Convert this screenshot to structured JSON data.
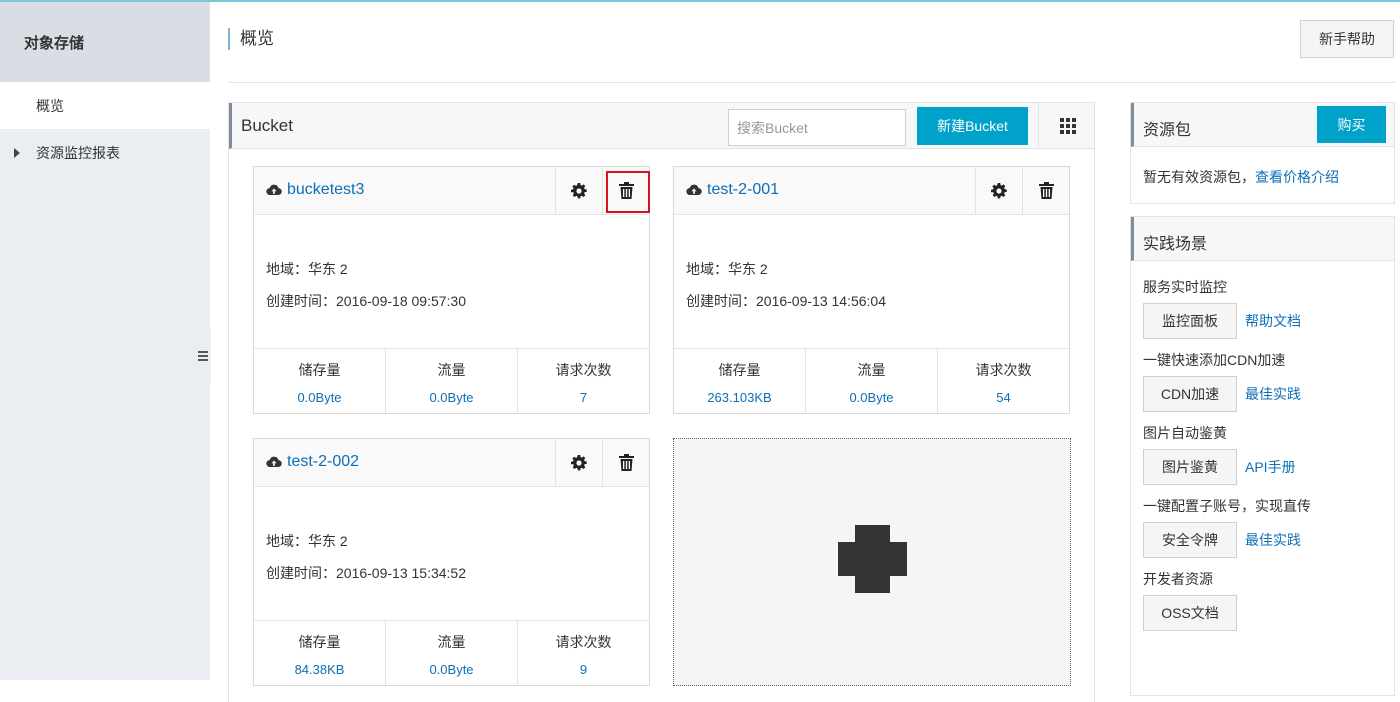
{
  "sidebar": {
    "title": "对象存储",
    "items": [
      {
        "label": "概览"
      },
      {
        "label": "资源监控报表"
      }
    ]
  },
  "header": {
    "title": "概览",
    "help_button": "新手帮助"
  },
  "bucket_panel": {
    "title": "Bucket",
    "search_placeholder": "搜索Bucket",
    "new_button": "新建Bucket",
    "buckets": [
      {
        "name": "bucketest3",
        "region": "地域：华东 2",
        "created": "创建时间：2016-09-18 09:57:30",
        "stats": [
          {
            "label": "储存量",
            "value": "0.0Byte"
          },
          {
            "label": "流量",
            "value": "0.0Byte"
          },
          {
            "label": "请求次数",
            "value": "7"
          }
        ]
      },
      {
        "name": "test-2-001",
        "region": "地域：华东 2",
        "created": "创建时间：2016-09-13 14:56:04",
        "stats": [
          {
            "label": "储存量",
            "value": "263.103KB"
          },
          {
            "label": "流量",
            "value": "0.0Byte"
          },
          {
            "label": "请求次数",
            "value": "54"
          }
        ]
      },
      {
        "name": "test-2-002",
        "region": "地域：华东 2",
        "created": "创建时间：2016-09-13 15:34:52",
        "stats": [
          {
            "label": "储存量",
            "value": "84.38KB"
          },
          {
            "label": "流量",
            "value": "0.0Byte"
          },
          {
            "label": "请求次数",
            "value": "9"
          }
        ]
      }
    ]
  },
  "resource_panel": {
    "title": "资源包",
    "buy_button": "购买",
    "empty_text": "暂无有效资源包，",
    "price_link": "查看价格介绍"
  },
  "practice_panel": {
    "title": "实践场景",
    "scenes": [
      {
        "title": "服务实时监控",
        "button": "监控面板",
        "link": "帮助文档"
      },
      {
        "title": "一键快速添加CDN加速",
        "button": "CDN加速",
        "link": "最佳实践"
      },
      {
        "title": "图片自动鉴黄",
        "button": "图片鉴黄",
        "link": "API手册"
      },
      {
        "title": "一键配置子账号，实现直传",
        "button": "安全令牌",
        "link": "最佳实践"
      },
      {
        "title": "开发者资源",
        "button": "OSS文档",
        "link": ""
      }
    ]
  },
  "colors": {
    "accent": "#00a2ca",
    "link": "#0c6fb8",
    "highlight": "#d9131b"
  }
}
